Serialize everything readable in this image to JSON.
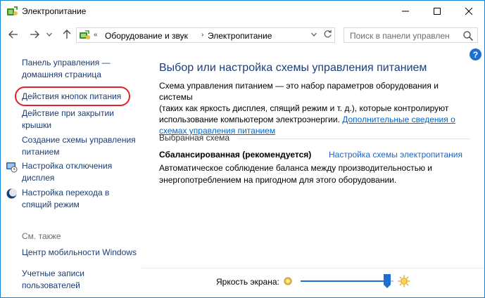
{
  "window": {
    "title": "Электропитание"
  },
  "address": {
    "chevron": "«",
    "segment1": "Оборудование и звук",
    "separator": "›",
    "segment2": "Электропитание"
  },
  "search": {
    "placeholder": "Поиск в панели управлен"
  },
  "help": {
    "label": "?"
  },
  "sidebar": {
    "home": [
      "Панель управления —",
      "домашняя страница"
    ],
    "power_buttons": "Действия кнопок питания",
    "lid_close": [
      "Действие при закрытии",
      "крышки"
    ],
    "create_plan": [
      "Создание схемы управления",
      "питанием"
    ],
    "display_off": [
      "Настройка отключения",
      "дисплея"
    ],
    "sleep_mode": [
      "Настройка перехода в",
      "спящий режим"
    ],
    "see_also": "См. также",
    "mobility_center": "Центр мобильности Windows",
    "user_accounts": [
      "Учетные записи",
      "пользователей"
    ]
  },
  "main": {
    "heading": "Выбор или настройка схемы управления питанием",
    "desc_line1": "Схема управления питанием — это набор параметров оборудования и системы",
    "desc_line2": "(таких как яркость дисплея, спящий режим и т. д.), которые контролируют",
    "desc_line3": "использование компьютером электроэнергии.",
    "desc_link_part1": "Дополнительные сведения о",
    "desc_link_part2": "схемах управления питанием",
    "selected_label": "Выбранная схема",
    "plan_name": "Сбалансированная (рекомендуется)",
    "plan_settings_link": "Настройка схемы электропитания",
    "plan_desc_line1": "Автоматическое соблюдение баланса между производительностью и",
    "plan_desc_line2": "энергопотреблением на пригодном для этого оборудовании."
  },
  "footer": {
    "brightness_label": "Яркость экрана:",
    "brightness_level": 0.93
  },
  "colors": {
    "accent": "#1e6fd0",
    "link": "#1b3d73",
    "highlight": "#e0202a"
  }
}
